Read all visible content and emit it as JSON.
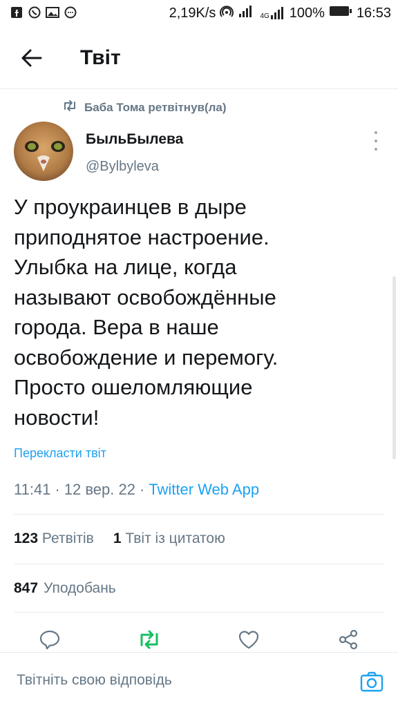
{
  "status_bar": {
    "speed": "2,19K/s",
    "battery_percent": "100%",
    "time": "16:53",
    "network": "4G",
    "left_icons": [
      "facebook-icon",
      "viber-icon",
      "gallery-icon",
      "chat-icon"
    ]
  },
  "header": {
    "title": "Твіт",
    "back_icon": "arrow-left-icon"
  },
  "retweet": {
    "text": "Баба Тома ретвітнув(ла)"
  },
  "author": {
    "name": "БыльБылева",
    "handle": "@Bylbyleva"
  },
  "tweet": {
    "text": "У проукраинцев в дыре\nприподнятое настроение.\nУлыбка на лице, когда\nназывают освобождённые\nгорода. Вера в наше\nосвобождение и перемогу.\nПросто ошеломляющие\nновости!",
    "translate": "Перекласти твіт",
    "time": "11:41",
    "sep": "·",
    "date": "12 вер. 22",
    "app": "Twitter Web App"
  },
  "stats": {
    "retweets_count": "123",
    "retweets_label": "Ретвітів",
    "quotes_count": "1",
    "quotes_label": "Твіт із цитатою",
    "likes_count": "847",
    "likes_label": "Уподобань"
  },
  "reply": {
    "placeholder": "Твітніть свою відповідь"
  },
  "colors": {
    "accent": "#1da1f2",
    "retweet_active": "#17bf63",
    "secondary_text": "#657786"
  }
}
